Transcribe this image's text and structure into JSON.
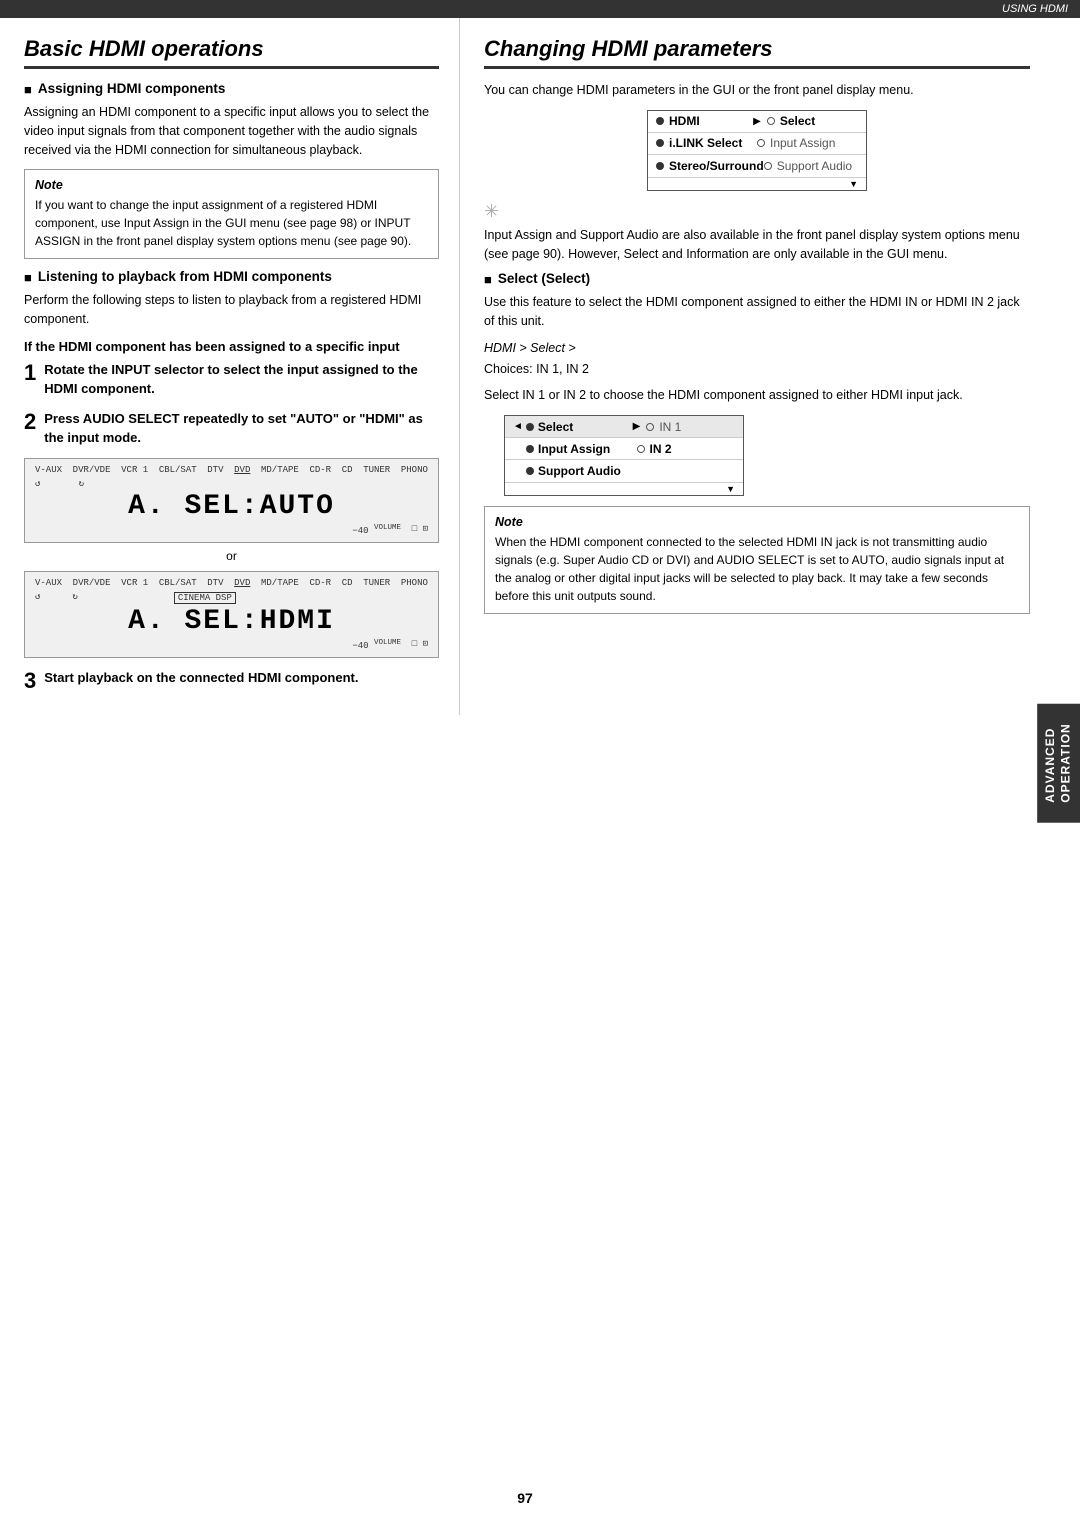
{
  "topBar": {
    "label": "USING HDMI"
  },
  "rightTab": {
    "line1": "ADVANCED",
    "line2": "OPERATION"
  },
  "leftSection": {
    "title": "Basic HDMI operations",
    "subsections": [
      {
        "heading": "Assigning HDMI components",
        "body": "Assigning an HDMI component to a specific input allows you to select the video input signals from that component together with the audio signals received via the HDMI connection for simultaneous playback."
      }
    ],
    "noteBox": {
      "title": "Note",
      "text": "If you want to change the input assignment of a registered HDMI component, use Input Assign in the GUI menu (see page 98) or INPUT ASSIGN in the front panel display system options menu (see page 90)."
    },
    "subsection2": {
      "heading": "Listening to playback from HDMI components",
      "body": "Perform the following steps to listen to playback from a registered HDMI component."
    },
    "boldSubhead": "If the HDMI component has been assigned to a specific input",
    "steps": [
      {
        "number": "1",
        "text": "Rotate the INPUT selector to select the input assigned to the HDMI component."
      },
      {
        "number": "2",
        "text": "Press AUDIO SELECT repeatedly to set \"AUTO\" or \"HDMI\" as the input mode."
      }
    ],
    "display1": {
      "topLabels": [
        "V-AUX",
        "DVR/VCR",
        "VCR 1",
        "CBL/SAT",
        "DTV",
        "DVD",
        "MD/TAPE",
        "CD-R",
        "CD",
        "TUNER",
        "PHONO"
      ],
      "mainText": "A. SEL:AUTO",
      "volumeText": "-40"
    },
    "orText": "or",
    "display2": {
      "topLabels": [
        "V-AUX",
        "DVR/VCR",
        "VCR 1",
        "CBL/SAT",
        "DTV",
        "DVD",
        "MD/TAPE",
        "CD-R",
        "CD",
        "TUNER",
        "PHONO"
      ],
      "mainText": "A. SEL:HDMI",
      "volumeText": "-40"
    },
    "step3": {
      "number": "3",
      "text": "Start playback on the connected HDMI component."
    }
  },
  "rightSection": {
    "title": "Changing HDMI parameters",
    "intro": "You can change HDMI parameters in the GUI or the front panel display menu.",
    "guiMenuTop": {
      "rows": [
        {
          "left": "HDMI",
          "leftBullet": true,
          "arrow": "▶",
          "right": "Select",
          "rightHighlight": true,
          "rightBullet": false
        },
        {
          "left": "i.LINK Select",
          "leftBullet": true,
          "arrow": "",
          "right": "Input Assign",
          "rightHighlight": false,
          "rightBullet": false
        },
        {
          "left": "Stereo/Surround",
          "leftBullet": true,
          "arrow": "",
          "right": "Support Audio",
          "rightHighlight": false,
          "rightBullet": false
        }
      ]
    },
    "hintText": "Input Assign and Support Audio are also available in the front panel display system options menu (see page 90). However, Select and Information are only available in the GUI menu.",
    "selectSection": {
      "heading": "Select (Select)",
      "body": "Use this feature to select the HDMI component assigned to either the HDMI IN or HDMI IN 2 jack of this unit.",
      "path": "HDMI > Select >",
      "choices": "Choices: IN 1, IN 2",
      "bodyAfter": "Select IN 1 or IN 2 to choose the HDMI component assigned to either HDMI input jack."
    },
    "guiMenuBottom": {
      "rows": [
        {
          "left": "Select",
          "leftBullet": true,
          "leftArrowLeft": "◄",
          "arrow": "▶",
          "right": "IN 1",
          "rightBullet": false,
          "rightHighlight": false
        },
        {
          "left": "Input Assign",
          "leftBullet": true,
          "leftArrowLeft": "",
          "arrow": "",
          "right": "IN 2",
          "rightBullet": false,
          "rightHighlight": true
        },
        {
          "left": "Support Audio",
          "leftBullet": true,
          "leftArrowLeft": "",
          "arrow": "",
          "right": "",
          "rightBullet": false,
          "rightHighlight": false
        }
      ]
    },
    "noteBox": {
      "title": "Note",
      "text": "When the HDMI component connected to the selected HDMI IN jack is not transmitting audio signals (e.g. Super Audio CD or DVI) and AUDIO SELECT is set to AUTO, audio signals input at the analog or other digital input jacks will be selected to play back. It may take a few seconds before this unit outputs sound."
    }
  },
  "pageNumber": "97"
}
